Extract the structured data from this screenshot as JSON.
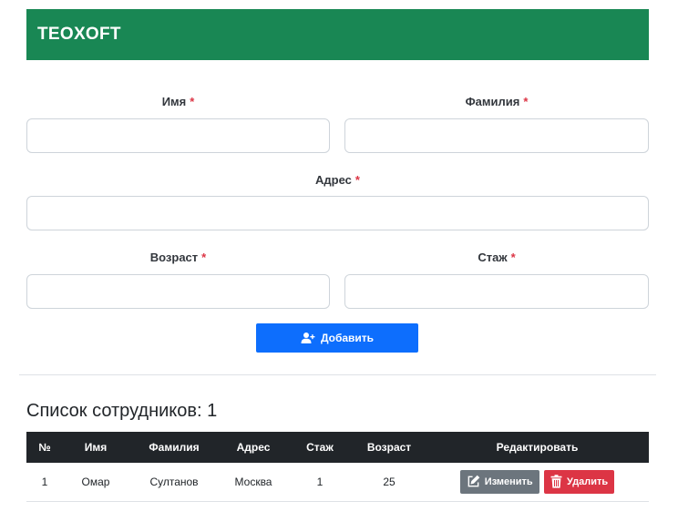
{
  "header": {
    "brand": "TEOXOFT"
  },
  "form": {
    "first_name_label": "Имя",
    "last_name_label": "Фамилия",
    "address_label": "Адрес",
    "age_label": "Возраст",
    "experience_label": "Стаж",
    "required_mark": "*",
    "first_name_value": "",
    "last_name_value": "",
    "address_value": "",
    "age_value": "",
    "experience_value": "",
    "add_button_label": "Добавить"
  },
  "employees": {
    "title": "Список сотрудников: 1",
    "columns": [
      "№",
      "Имя",
      "Фамилия",
      "Адрес",
      "Стаж",
      "Возраст",
      "Редактировать"
    ],
    "rows": [
      {
        "num": "1",
        "first_name": "Омар",
        "last_name": "Султанов",
        "address": "Москва",
        "experience": "1",
        "age": "25"
      }
    ],
    "edit_label": "Изменить",
    "delete_label": "Удалить"
  },
  "colors": {
    "header_bg": "#198754",
    "primary": "#0d6efd",
    "secondary": "#6c757d",
    "danger": "#dc3545",
    "table_head": "#212529"
  },
  "icons": {
    "add_button": "user-plus-icon",
    "edit_button": "pencil-square-icon",
    "delete_button": "trash-icon"
  }
}
